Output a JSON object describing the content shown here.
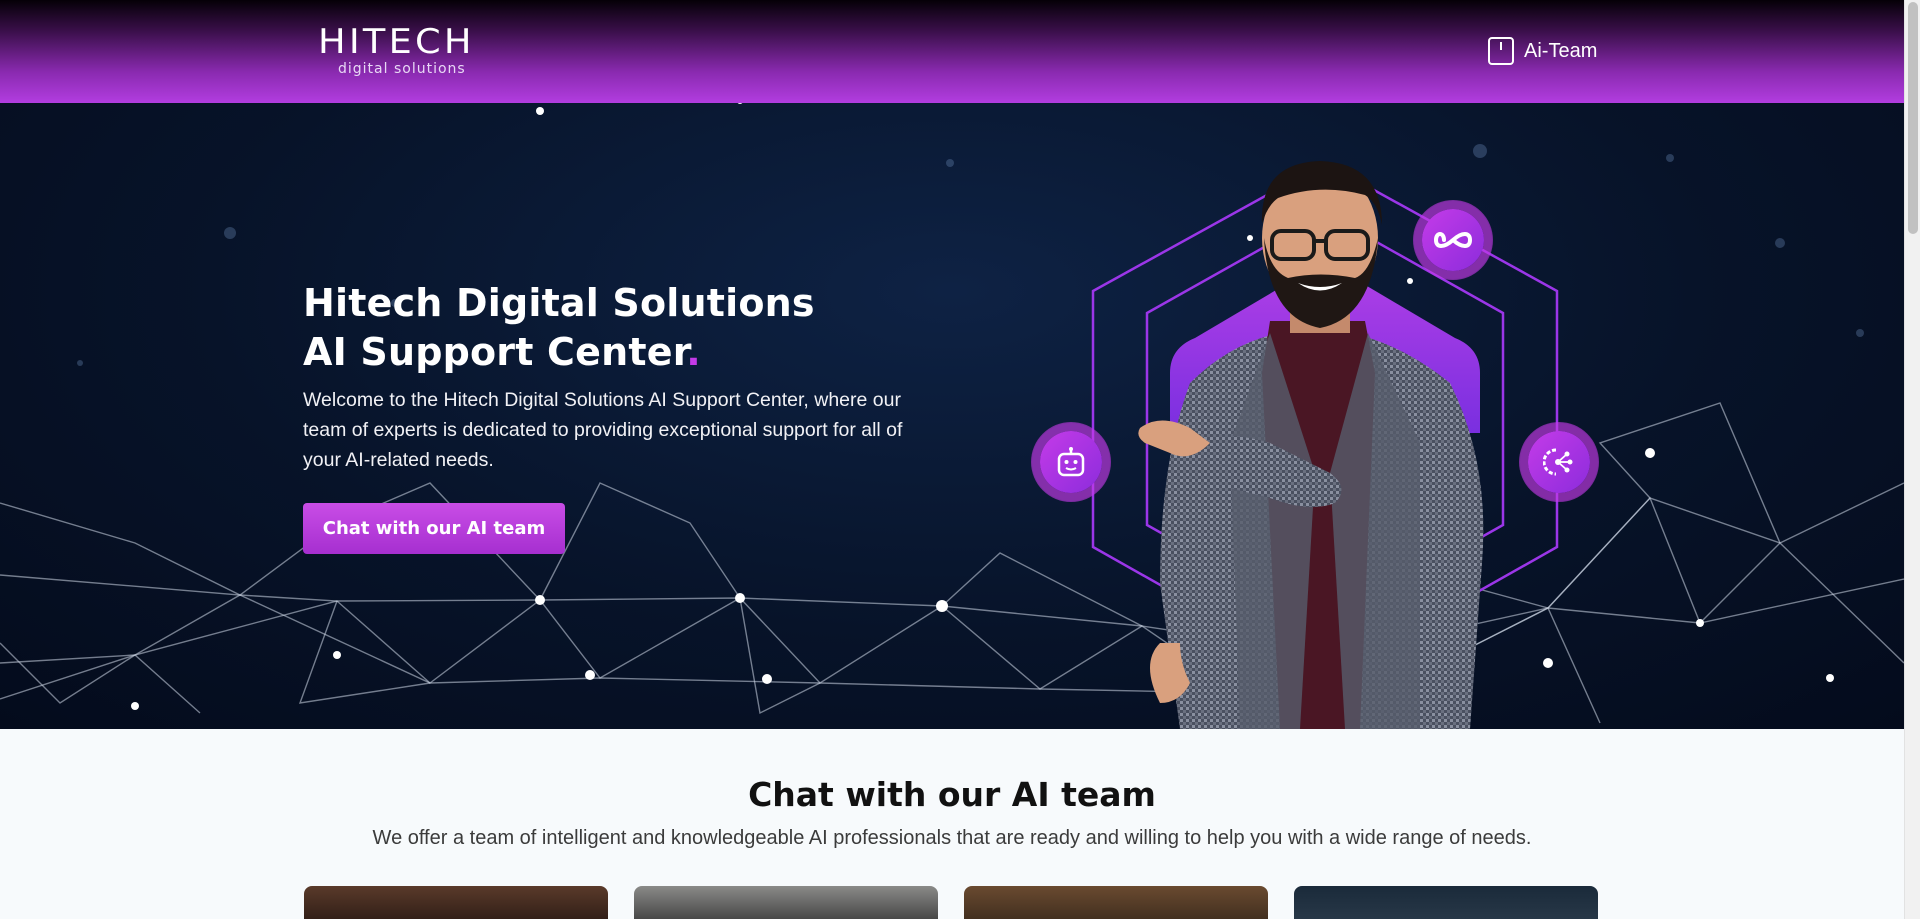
{
  "header": {
    "logo": {
      "main": "HITECH",
      "sub": "digital solutions"
    },
    "nav": {
      "label": "Ai-Team",
      "icon": "tablet-icon"
    }
  },
  "hero": {
    "title_line1": "Hitech Digital Solutions",
    "title_line2": "AI Support Center",
    "title_dot": ".",
    "description": "Welcome to the Hitech Digital Solutions AI Support Center, where our team of experts is dedicated to providing exceptional support for all of your AI-related needs.",
    "cta_label": "Chat with our AI team",
    "feature_icons": [
      "infinity-icon",
      "robot-icon",
      "network-icon"
    ]
  },
  "section": {
    "title": "Chat with our AI team",
    "subtitle": "We offer a team of intelligent and knowledgeable AI professionals that are ready and willing to help you with a wide range of needs."
  },
  "colors": {
    "accent": "#c43be8",
    "header_gradient_end": "#b23de0",
    "hero_bg": "#071329"
  }
}
